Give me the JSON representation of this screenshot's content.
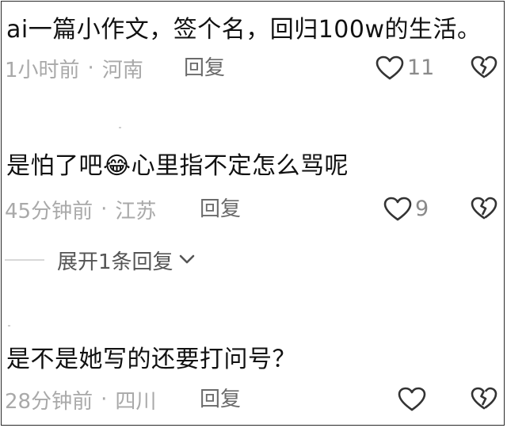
{
  "comments": [
    {
      "text": "ai一篇小作文，签个名，回归100w的生活。",
      "time": "1小时前",
      "separator": "·",
      "location": "河南",
      "reply_label": "回复",
      "likes": "11"
    },
    {
      "text_before": "是怕了吧",
      "emoji": "😂",
      "text_after": "心里指不定怎么骂呢",
      "time": "45分钟前",
      "separator": "·",
      "location": "江苏",
      "reply_label": "回复",
      "likes": "9"
    },
    {
      "text": "是不是她写的还要打问号？",
      "time": "28分钟前",
      "separator": "·",
      "location": "四川",
      "reply_label": "回复",
      "likes": ""
    }
  ],
  "expand_replies": {
    "label": "展开1条回复"
  },
  "icons": {
    "like": "heart-outline-icon",
    "dislike": "broken-heart-icon",
    "expand": "chevron-down-icon"
  },
  "colors": {
    "text": "#111111",
    "meta": "#a9a9a9",
    "reply": "#6b6b6b",
    "icon": "#333333"
  }
}
